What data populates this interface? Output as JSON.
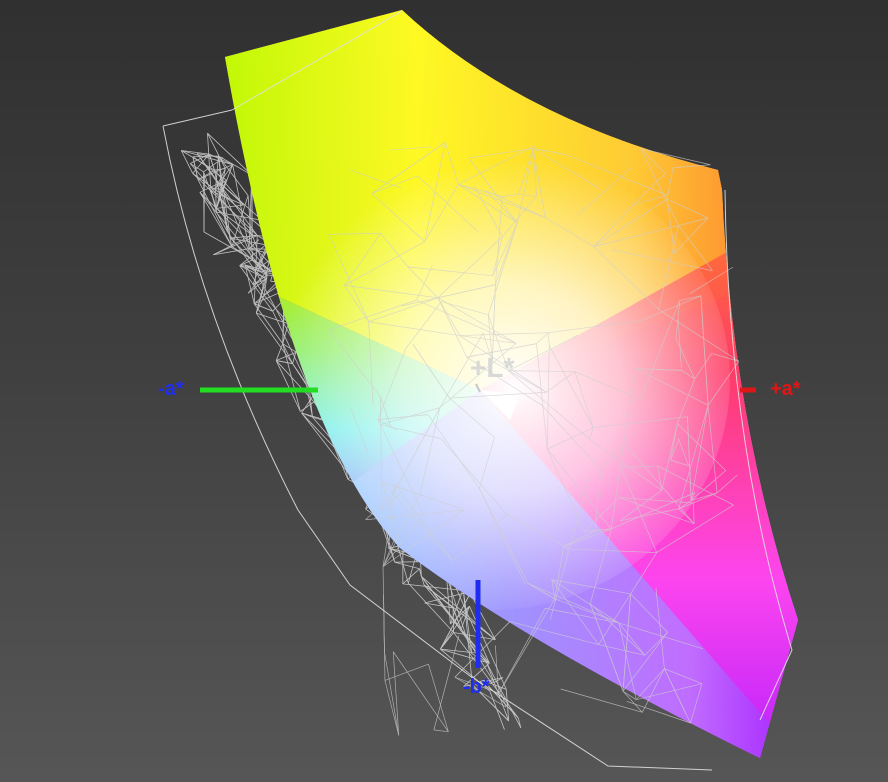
{
  "axes": {
    "neg_a": {
      "label": "-a*",
      "color": "#1f2df0",
      "line_color": "#22dd22"
    },
    "pos_a": {
      "label": "+a*",
      "color": "#e01515",
      "line_color": "#e01515"
    },
    "neg_b": {
      "label": "-b*",
      "color": "#1f2df0",
      "line_color": "#1f2df0"
    },
    "pos_l": {
      "label": "+L*",
      "color": "#d2d2d2"
    }
  },
  "solid_gamut": {
    "corner_colors": {
      "top_left": "#b6ff00",
      "top_mid": "#ffff22",
      "top_right": "#ff7a2a",
      "right_mid": "#ff3070",
      "bottom_right": "#b11dff",
      "bottom_mid": "#9a9aff",
      "left_mid": "#66ffee",
      "center": "#ffffff"
    }
  },
  "wireframe_gamut": {
    "color": "#d8d8d8"
  },
  "background": {
    "top": "#303030",
    "bottom": "#565656"
  }
}
